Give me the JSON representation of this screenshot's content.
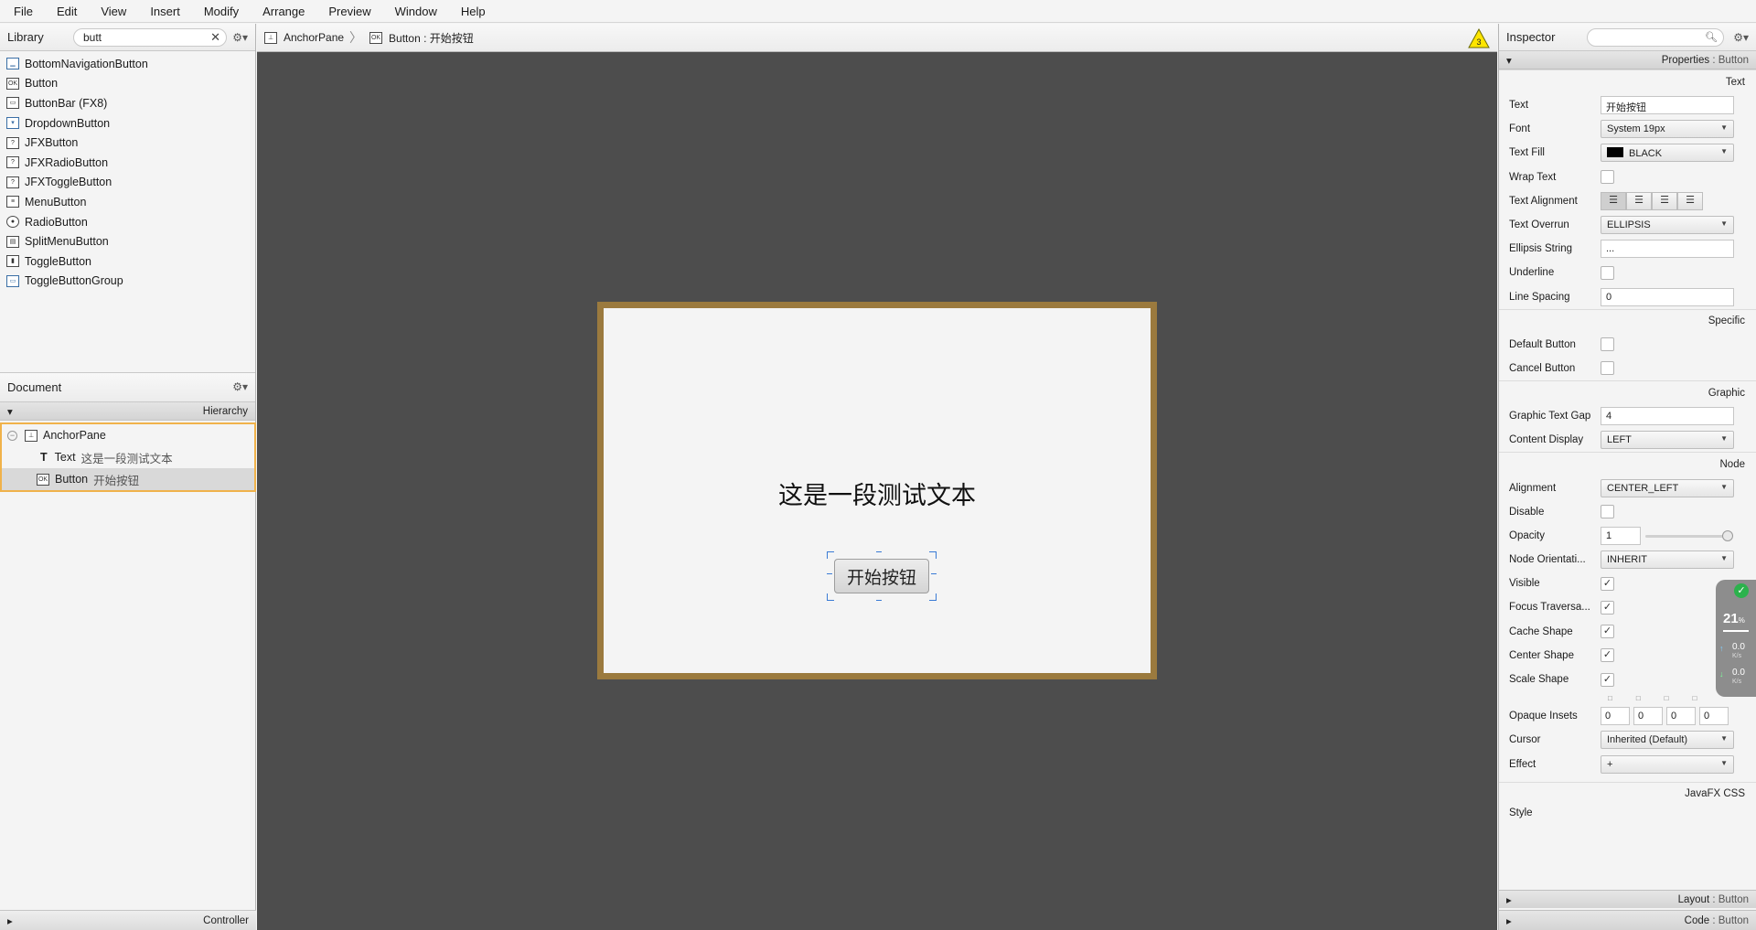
{
  "menu": [
    "File",
    "Edit",
    "View",
    "Insert",
    "Modify",
    "Arrange",
    "Preview",
    "Window",
    "Help"
  ],
  "library": {
    "title": "Library",
    "search_value": "butt",
    "items": [
      {
        "label": "BottomNavigationButton",
        "icon": "bottom-nav-icon"
      },
      {
        "label": "Button",
        "icon": "ok-button-icon",
        "glyph": "OK"
      },
      {
        "label": "ButtonBar  (FX8)",
        "icon": "button-bar-icon"
      },
      {
        "label": "DropdownButton",
        "icon": "dropdown-button-icon"
      },
      {
        "label": "JFXButton",
        "icon": "unknown-component-icon",
        "glyph": "?"
      },
      {
        "label": "JFXRadioButton",
        "icon": "unknown-component-icon",
        "glyph": "?"
      },
      {
        "label": "JFXToggleButton",
        "icon": "unknown-component-icon",
        "glyph": "?"
      },
      {
        "label": "MenuButton",
        "icon": "menu-button-icon"
      },
      {
        "label": "RadioButton",
        "icon": "radio-button-icon"
      },
      {
        "label": "SplitMenuButton",
        "icon": "split-menu-button-icon"
      },
      {
        "label": "ToggleButton",
        "icon": "toggle-button-icon"
      },
      {
        "label": "ToggleButtonGroup",
        "icon": "toggle-button-group-icon"
      }
    ]
  },
  "document": {
    "title": "Document",
    "hierarchy_label": "Hierarchy",
    "tree": [
      {
        "type": "AnchorPane",
        "text": ""
      },
      {
        "type": "Text",
        "text": "这是一段测试文本"
      },
      {
        "type": "Button",
        "text": "开始按钮"
      }
    ],
    "controller_label": "Controller"
  },
  "breadcrumb": {
    "root": "AnchorPane",
    "current_type": "Button",
    "current_sep": " : ",
    "current_text": "开始按钮",
    "warning_count": "3"
  },
  "canvas": {
    "text": "这是一段测试文本",
    "button_text": "开始按钮",
    "border_color": "#9b7a3e",
    "background": "#4d4d4d"
  },
  "inspector": {
    "title": "Inspector",
    "properties_label": "Properties",
    "properties_target": "Button",
    "sections": {
      "text": "Text",
      "specific": "Specific",
      "graphic": "Graphic",
      "node": "Node",
      "css": "JavaFX CSS"
    },
    "props": {
      "text": {
        "label": "Text",
        "value": "开始按钮"
      },
      "font": {
        "label": "Font",
        "value": "System 19px"
      },
      "text_fill": {
        "label": "Text Fill",
        "value": "BLACK"
      },
      "wrap_text": {
        "label": "Wrap Text"
      },
      "text_alignment": {
        "label": "Text Alignment"
      },
      "text_overrun": {
        "label": "Text Overrun",
        "value": "ELLIPSIS"
      },
      "ellipsis_string": {
        "label": "Ellipsis String",
        "value": "..."
      },
      "underline": {
        "label": "Underline"
      },
      "line_spacing": {
        "label": "Line Spacing",
        "value": "0"
      },
      "default_button": {
        "label": "Default Button"
      },
      "cancel_button": {
        "label": "Cancel Button"
      },
      "graphic_text_gap": {
        "label": "Graphic Text Gap",
        "value": "4"
      },
      "content_display": {
        "label": "Content Display",
        "value": "LEFT"
      },
      "alignment": {
        "label": "Alignment",
        "value": "CENTER_LEFT"
      },
      "disable": {
        "label": "Disable"
      },
      "opacity": {
        "label": "Opacity",
        "value": "1"
      },
      "node_orientation": {
        "label": "Node Orientati...",
        "value": "INHERIT"
      },
      "visible": {
        "label": "Visible"
      },
      "focus_traversable": {
        "label": "Focus Traversa..."
      },
      "cache_shape": {
        "label": "Cache Shape"
      },
      "center_shape": {
        "label": "Center Shape"
      },
      "scale_shape": {
        "label": "Scale Shape"
      },
      "opaque_insets": {
        "label": "Opaque Insets",
        "values": [
          "0",
          "0",
          "0",
          "0"
        ]
      },
      "cursor": {
        "label": "Cursor",
        "value": "Inherited (Default)"
      },
      "effect": {
        "label": "Effect",
        "value": "+"
      },
      "style": {
        "label": "Style"
      }
    },
    "layout_label": "Layout",
    "code_label": "Code",
    "panel_target": "Button"
  },
  "widget": {
    "percent": "21",
    "percent_unit": "%",
    "up": "0.0",
    "up_unit": "K/s",
    "down": "0.0",
    "down_unit": "K/s"
  }
}
